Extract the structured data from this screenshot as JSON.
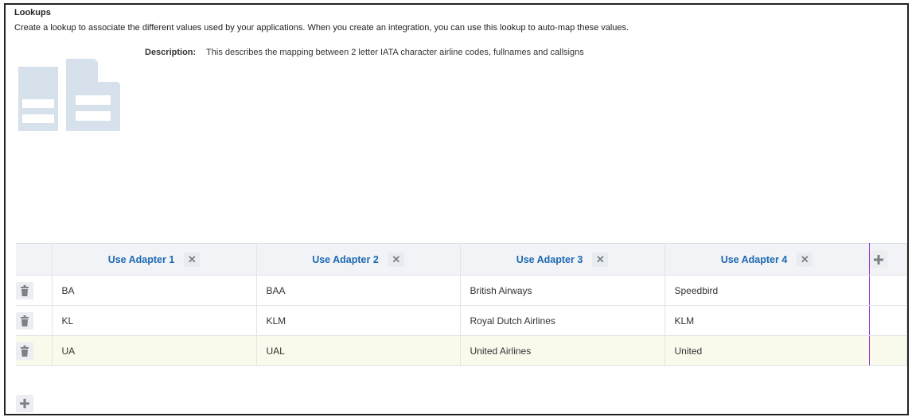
{
  "header": {
    "title": "Lookups",
    "description": "Create a lookup to associate the different values used by your applications. When you create an integration, you can use this lookup to auto-map these values."
  },
  "details": {
    "description_label": "Description:",
    "description_value": "This describes the mapping between 2 letter IATA character airline codes, fullnames and callsigns"
  },
  "table": {
    "columns": [
      {
        "label": "Use Adapter 1"
      },
      {
        "label": "Use Adapter 2"
      },
      {
        "label": "Use Adapter 3"
      },
      {
        "label": "Use Adapter 4"
      }
    ],
    "rows": [
      {
        "cells": [
          "BA",
          "BAA",
          "British Airways",
          "Speedbird"
        ],
        "highlighted": false
      },
      {
        "cells": [
          "KL",
          "KLM",
          "Royal Dutch Airlines",
          "KLM"
        ],
        "highlighted": false
      },
      {
        "cells": [
          "UA",
          "UAL",
          "United Airlines",
          "United"
        ],
        "highlighted": true
      }
    ]
  },
  "icons": {
    "document": "document-icon",
    "remove_column": "close-icon",
    "delete_row": "trash-icon",
    "add": "plus-icon"
  },
  "colors": {
    "header_link": "#1d68b3",
    "row_highlight": "#f9faec",
    "column_divider": "#8e2fd6",
    "icon_fill": "#d6e1eb"
  }
}
